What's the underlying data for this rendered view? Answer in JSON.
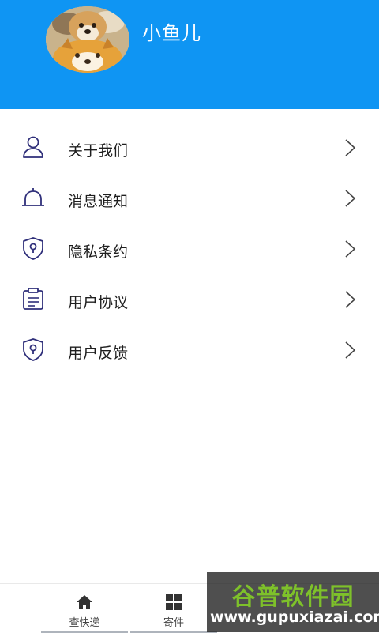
{
  "profile": {
    "username": "小鱼儿"
  },
  "menu": [
    {
      "label": "关于我们",
      "icon": "user-icon"
    },
    {
      "label": "消息通知",
      "icon": "bell-icon"
    },
    {
      "label": "隐私条约",
      "icon": "shield-icon"
    },
    {
      "label": "用户协议",
      "icon": "clipboard-icon"
    },
    {
      "label": "用户反馈",
      "icon": "shield-icon"
    }
  ],
  "tabbar": {
    "tabs": [
      {
        "label": "查快递",
        "icon": "home-icon"
      },
      {
        "label": "寄件",
        "icon": "grid-icon"
      }
    ]
  },
  "watermark": {
    "title": "谷普软件园",
    "url": "www.gupuxiazai.com"
  },
  "colors": {
    "header": "#0f95f3",
    "icon_stroke": "#2f2f7a",
    "watermark_green": "#7ec12a"
  }
}
